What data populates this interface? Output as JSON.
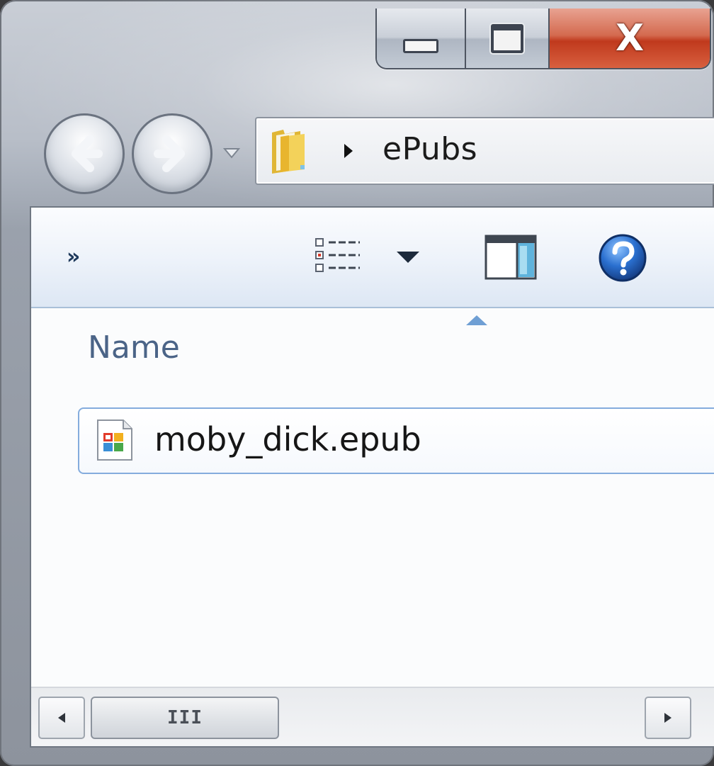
{
  "window": {
    "caption_buttons": {
      "minimize_icon": "minimize-icon",
      "maximize_icon": "maximize-icon",
      "close_glyph": "X"
    }
  },
  "navigation": {
    "back_icon": "back-arrow-icon",
    "forward_icon": "forward-arrow-icon",
    "recent_icon": "chevron-down-icon"
  },
  "address_bar": {
    "folder_icon": "folder-icon",
    "breadcrumb": [
      "ePubs"
    ]
  },
  "toolbar": {
    "overflow_label": "»",
    "views_icon": "details-view-icon",
    "views_dropdown_icon": "chevron-down-icon",
    "preview_pane_icon": "preview-pane-icon",
    "help_icon": "help-icon"
  },
  "file_list": {
    "columns": [
      {
        "label": "Name",
        "sorted": "ascending"
      }
    ],
    "files": [
      {
        "name": "moby_dick.epub",
        "icon": "epub-file-icon",
        "selected": true
      }
    ]
  },
  "scrollbar": {
    "thumb_grip": "III"
  },
  "colors": {
    "close_red": "#c7432a",
    "header_text": "#4b6487",
    "selection_border": "#84acdd"
  }
}
